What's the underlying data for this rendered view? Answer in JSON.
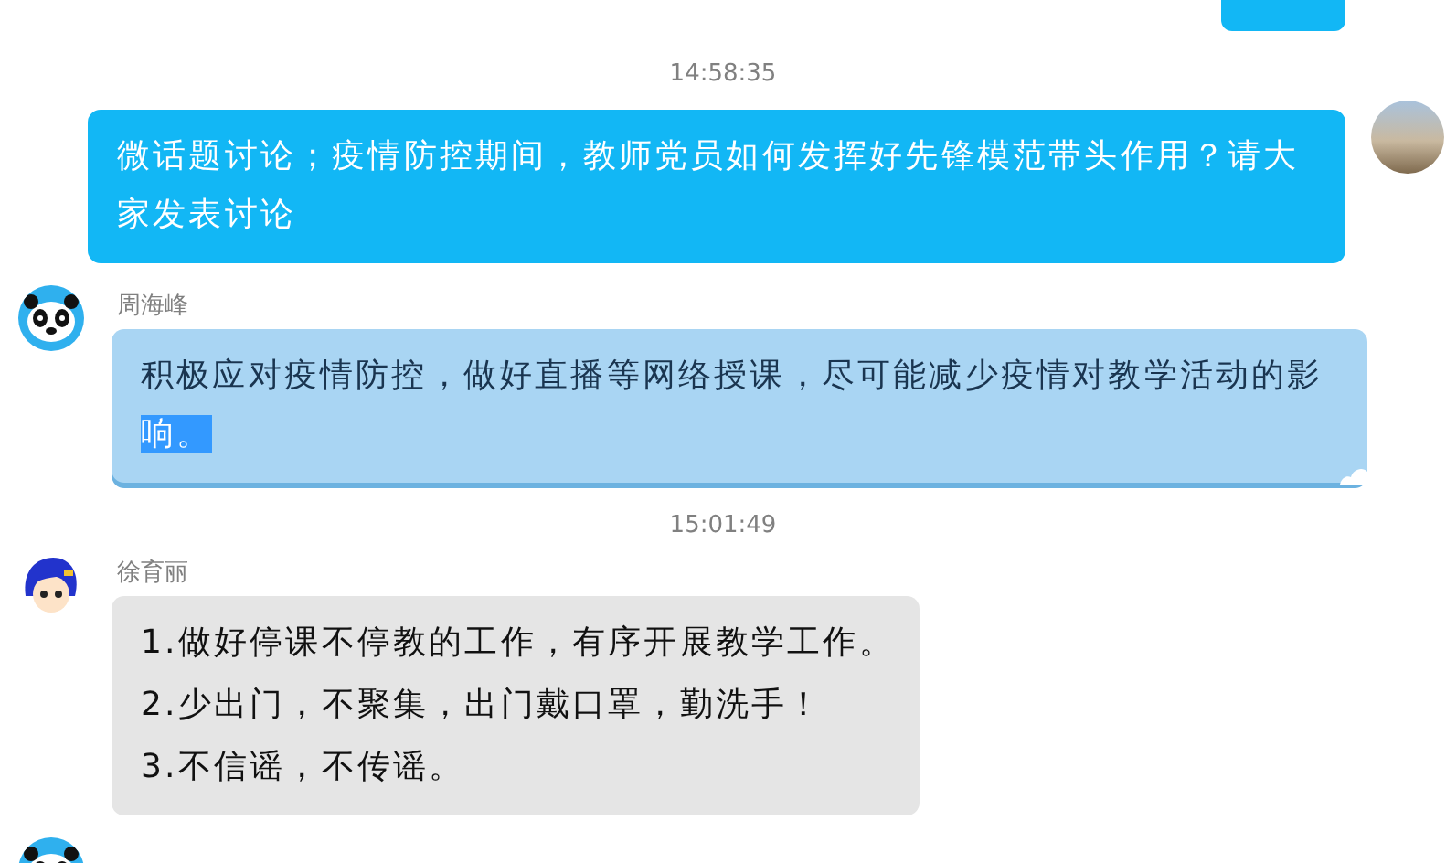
{
  "items": [
    {
      "kind": "partial"
    },
    {
      "kind": "timestamp",
      "text": "14:58:35"
    },
    {
      "kind": "outgoing",
      "text": "微话题讨论；疫情防控期间，教师党员如何发挥好先锋模范带头作用？请大家发表讨论"
    },
    {
      "kind": "incoming",
      "sender": "周海峰",
      "text": "积极应对疫情防控，做好直播等网络授课，尽可能减少疫情对教学活动的影",
      "selected_text": "响。"
    },
    {
      "kind": "timestamp",
      "text": "15:01:49"
    },
    {
      "kind": "plain",
      "sender": "徐育丽",
      "lines": [
        "1.做好停课不停教的工作，有序开展教学工作。",
        "2.少出门，不聚集，出门戴口罩，勤洗手！",
        "3.不信谣，不传谣。"
      ]
    },
    {
      "kind": "sender"
    }
  ]
}
